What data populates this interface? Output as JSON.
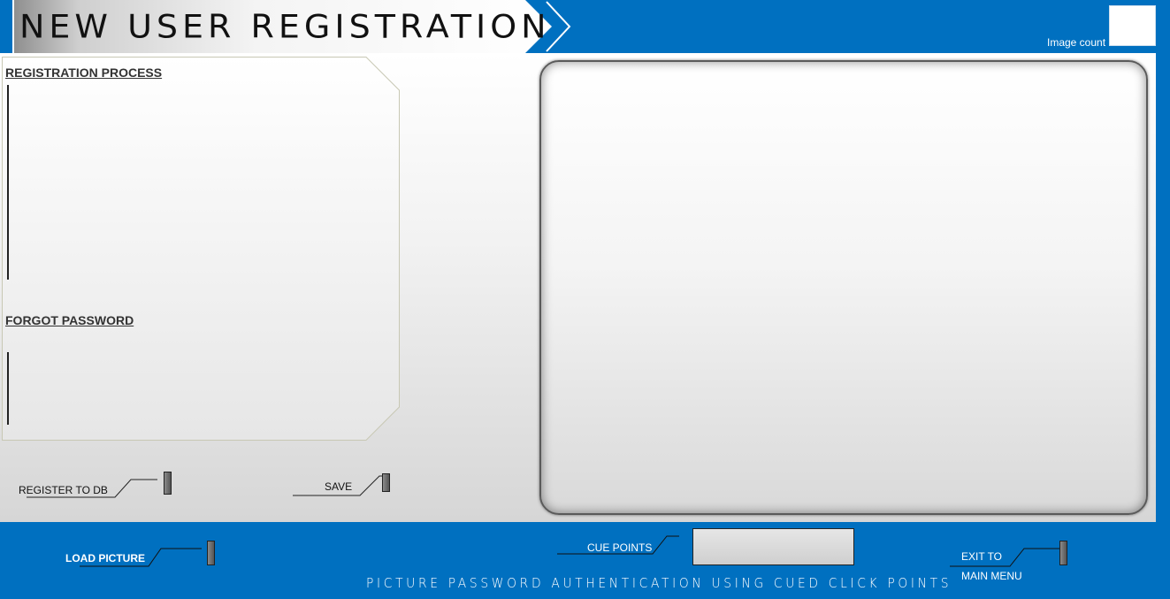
{
  "header": {
    "title": "NEW USER REGISTRATION",
    "image_count_label": "Image count"
  },
  "info_panel": {
    "registration_heading": "REGISTRATION PROCESS",
    "forgot_heading": "FORGOT PASSWORD"
  },
  "actions": {
    "register_label": "REGISTER TO DB",
    "save_label": "SAVE"
  },
  "bottom_bar": {
    "load_picture_label": "LOAD PICTURE",
    "cue_points_label": "CUE POINTS",
    "exit_label_line1": "EXIT TO",
    "exit_label_line2": "MAIN MENU",
    "caption": "PICTURE PASSWORD AUTHENTICATION USING CUED CLICK POINTS"
  },
  "colors": {
    "accent_blue": "#0070c0",
    "panel_gray": "#e6e6e6"
  }
}
